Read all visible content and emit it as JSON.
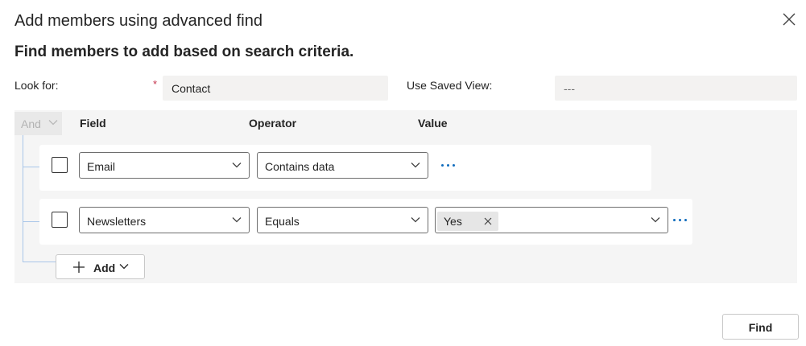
{
  "dialog": {
    "title": "Add members using advanced find",
    "subtitle": "Find members to add based on search criteria."
  },
  "form": {
    "look_for_label": "Look for:",
    "required_marker": "*",
    "look_for_value": "Contact",
    "saved_view_label": "Use Saved View:",
    "saved_view_value": "---"
  },
  "criteria": {
    "group_operator": "And",
    "headers": {
      "field": "Field",
      "operator": "Operator",
      "value": "Value"
    },
    "rows": [
      {
        "field": "Email",
        "operator": "Contains data"
      },
      {
        "field": "Newsletters",
        "operator": "Equals",
        "value_tag": "Yes"
      }
    ],
    "add_label": "Add"
  },
  "footer": {
    "find_label": "Find"
  },
  "colors": {
    "accent": "#0f6cbd",
    "tree_line": "#a9c6e9",
    "required": "#c4314b",
    "panel_bg": "#f5f5f5"
  },
  "icons": [
    "close-icon",
    "chevron-down-icon",
    "more-icon",
    "plus-icon",
    "dismiss-icon"
  ]
}
